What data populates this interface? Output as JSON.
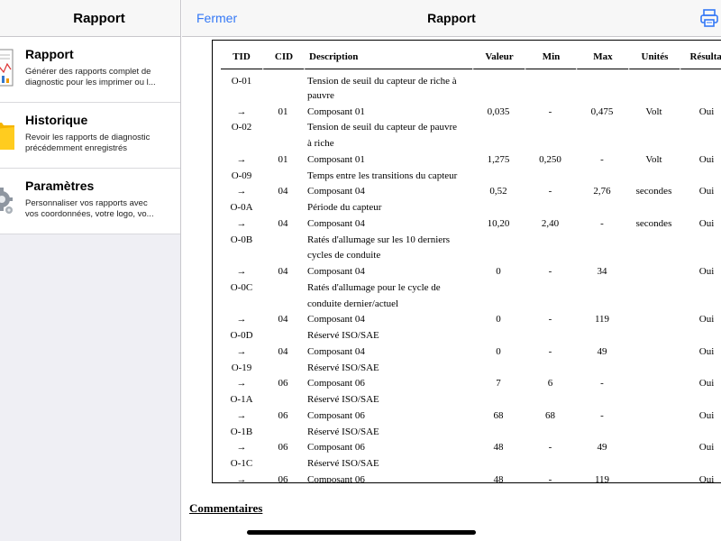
{
  "sidebar": {
    "title": "Rapport",
    "items": [
      {
        "title": "Rapport",
        "desc1": "Générer des rapports complet de",
        "desc2": "diagnostic pour les imprimer ou l...",
        "icon": "chart-report-icon"
      },
      {
        "title": "Historique",
        "desc1": "Revoir les rapports de diagnostic",
        "desc2": "précédemment enregistrés",
        "icon": "folder-icon"
      },
      {
        "title": "Paramètres",
        "desc1": "Personnaliser vos rapports avec",
        "desc2": "vos coordonnées, votre logo, vo...",
        "icon": "gear-icon"
      }
    ]
  },
  "header": {
    "close_label": "Fermer",
    "title": "Rapport",
    "print_icon": "printer-icon"
  },
  "colors": {
    "accent": "#3478f6"
  },
  "table": {
    "headers": [
      "TID",
      "CID",
      "Description",
      "Valeur",
      "Min",
      "Max",
      "Unités",
      "Résultat"
    ],
    "rows": [
      [
        "O-01",
        "",
        "Tension de seuil du capteur de riche à",
        "",
        "",
        "",
        "",
        ""
      ],
      [
        "",
        "",
        "pauvre",
        "",
        "",
        "",
        "",
        ""
      ],
      [
        "→",
        "01",
        "Composant 01",
        "0,035",
        "-",
        "0,475",
        "Volt",
        "Oui"
      ],
      [
        "O-02",
        "",
        "Tension de seuil du capteur de pauvre",
        "",
        "",
        "",
        "",
        ""
      ],
      [
        "",
        "",
        "à riche",
        "",
        "",
        "",
        "",
        ""
      ],
      [
        "→",
        "01",
        "Composant 01",
        "1,275",
        "0,250",
        "-",
        "Volt",
        "Oui"
      ],
      [
        "O-09",
        "",
        "Temps entre les transitions du capteur",
        "",
        "",
        "",
        "",
        ""
      ],
      [
        "→",
        "04",
        "Composant 04",
        "0,52",
        "-",
        "2,76",
        "secondes",
        "Oui"
      ],
      [
        "O-0A",
        "",
        "Période du capteur",
        "",
        "",
        "",
        "",
        ""
      ],
      [
        "→",
        "04",
        "Composant 04",
        "10,20",
        "2,40",
        "-",
        "secondes",
        "Oui"
      ],
      [
        "O-0B",
        "",
        "Ratés d'allumage sur les 10 derniers",
        "",
        "",
        "",
        "",
        ""
      ],
      [
        "",
        "",
        "cycles de conduite",
        "",
        "",
        "",
        "",
        ""
      ],
      [
        "→",
        "04",
        "Composant 04",
        "0",
        "-",
        "34",
        "",
        "Oui"
      ],
      [
        "O-0C",
        "",
        "Ratés d'allumage pour le cycle de",
        "",
        "",
        "",
        "",
        ""
      ],
      [
        "",
        "",
        "conduite dernier/actuel",
        "",
        "",
        "",
        "",
        ""
      ],
      [
        "→",
        "04",
        "Composant 04",
        "0",
        "-",
        "119",
        "",
        "Oui"
      ],
      [
        "O-0D",
        "",
        "Réservé ISO/SAE",
        "",
        "",
        "",
        "",
        ""
      ],
      [
        "→",
        "04",
        "Composant 04",
        "0",
        "-",
        "49",
        "",
        "Oui"
      ],
      [
        "O-19",
        "",
        "Réservé ISO/SAE",
        "",
        "",
        "",
        "",
        ""
      ],
      [
        "→",
        "06",
        "Composant 06",
        "7",
        "6",
        "-",
        "",
        "Oui"
      ],
      [
        "O-1A",
        "",
        "Réservé ISO/SAE",
        "",
        "",
        "",
        "",
        ""
      ],
      [
        "→",
        "06",
        "Composant 06",
        "68",
        "68",
        "-",
        "",
        "Oui"
      ],
      [
        "O-1B",
        "",
        "Réservé ISO/SAE",
        "",
        "",
        "",
        "",
        ""
      ],
      [
        "→",
        "06",
        "Composant 06",
        "48",
        "-",
        "49",
        "",
        "Oui"
      ],
      [
        "O-1C",
        "",
        "Réservé ISO/SAE",
        "",
        "",
        "",
        "",
        ""
      ],
      [
        "→",
        "06",
        "Composant 06",
        "48",
        "-",
        "119",
        "",
        "Oui"
      ]
    ]
  },
  "comments_label": "Commentaires"
}
